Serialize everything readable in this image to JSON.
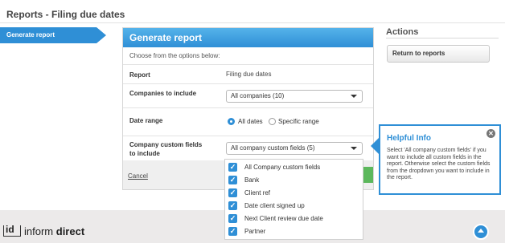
{
  "page": {
    "title": "Reports - Filing due dates"
  },
  "nav": {
    "active_item": "Generate report"
  },
  "panel": {
    "header": "Generate report",
    "instructions": "Choose from the options below:",
    "report": {
      "label": "Report",
      "value": "Filing due dates"
    },
    "companies": {
      "label": "Companies to include",
      "selected": "All companies (10)"
    },
    "date_range": {
      "label": "Date range",
      "options": [
        "All dates",
        "Specific range"
      ],
      "selected": "All dates"
    },
    "custom_fields": {
      "label_line1": "Company custom fields",
      "label_line2": "to include",
      "selected": "All company custom fields (5)"
    },
    "cancel_label": "Cancel"
  },
  "dropdown": {
    "items": [
      {
        "label": "All Company custom fields",
        "checked": true
      },
      {
        "label": "Bank",
        "checked": true
      },
      {
        "label": "Client ref",
        "checked": true
      },
      {
        "label": "Date client signed up",
        "checked": true
      },
      {
        "label": "Next Client review due date",
        "checked": true
      },
      {
        "label": "Partner",
        "checked": true
      }
    ]
  },
  "actions": {
    "title": "Actions",
    "return_label": "Return to reports"
  },
  "help": {
    "title": "Helpful Info",
    "text": "Select 'All company custom fields' if you want to include all custom fields in the report. Otherwise select the custom fields from the dropdown you want to include in the report."
  },
  "logo": {
    "brand_mark": "id",
    "text_regular": "inform",
    "text_bold": "direct"
  },
  "colors": {
    "accent": "#2f8fd6",
    "success": "#5cb85c"
  }
}
